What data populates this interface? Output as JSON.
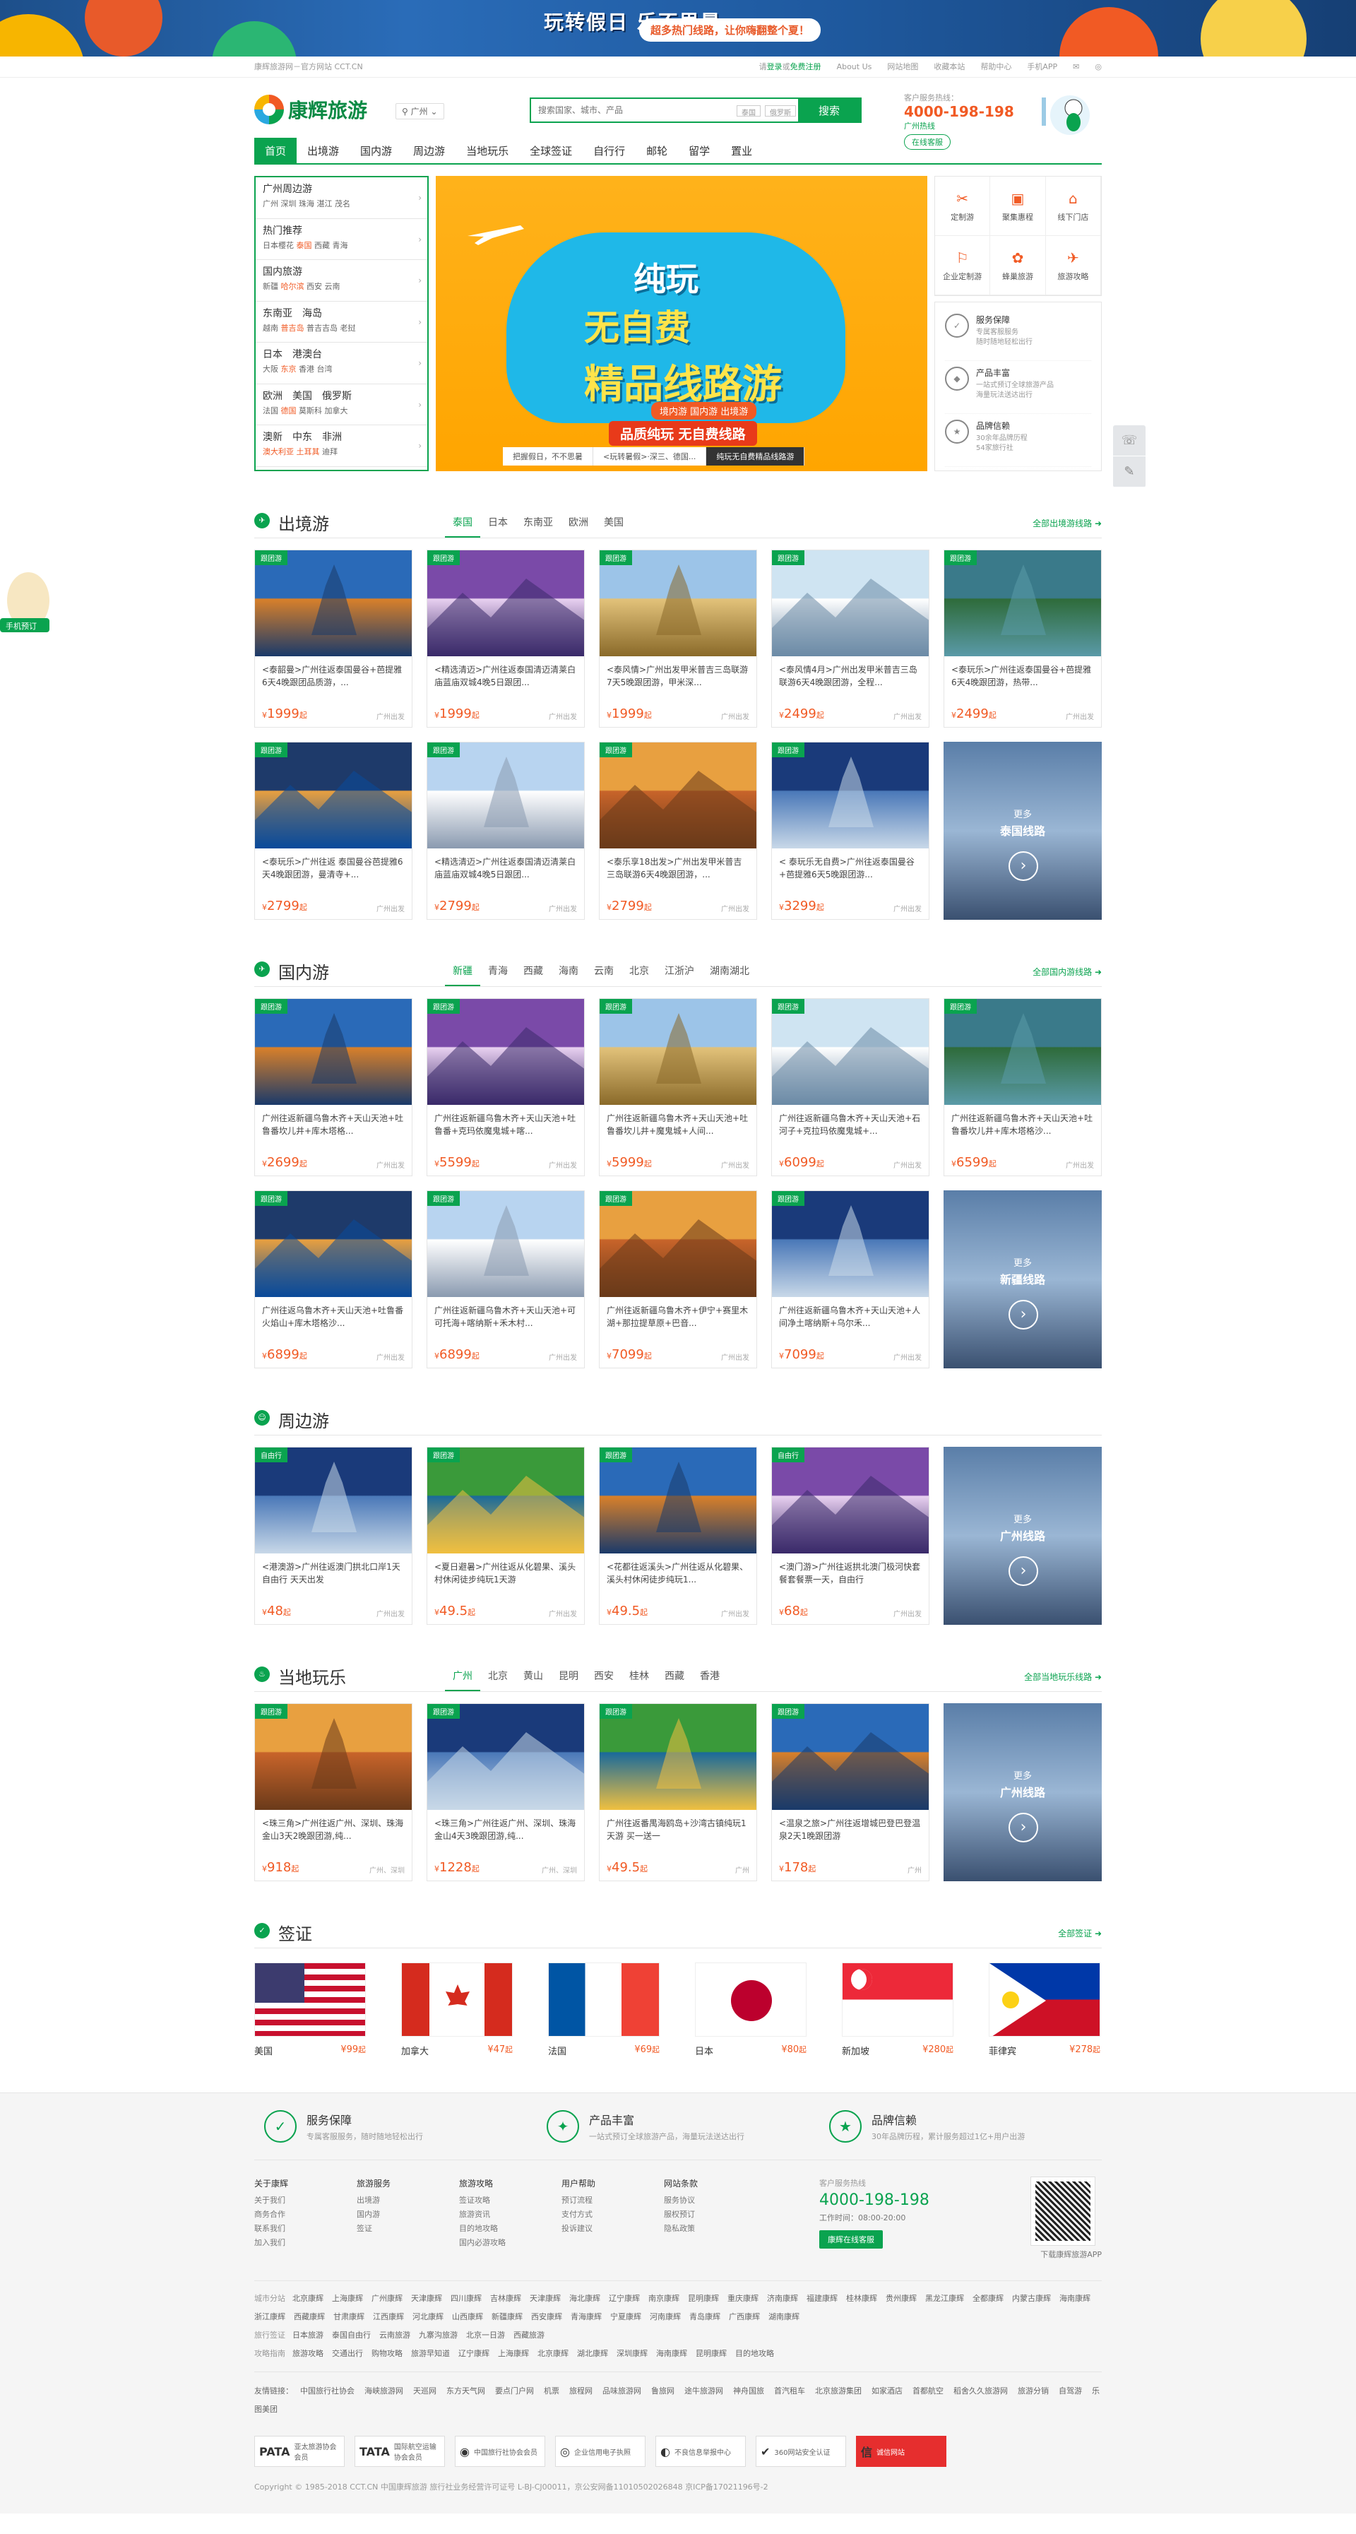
{
  "banner": {
    "slogan": "玩转假日 乐不思暑",
    "pill": "超多热门线路，让你嗨翻整个夏！"
  },
  "topbar": {
    "left": "康辉旅游网－官方网站 CCT.CN",
    "login_prefix": "请",
    "login": "登录",
    "or": "或",
    "register": "免费注册",
    "links": [
      "About Us",
      "网站地图",
      "收藏本站",
      "帮助中心",
      "手机APP"
    ]
  },
  "header": {
    "brand": "康辉旅游",
    "city": "广州",
    "search_placeholder": "搜索国家、城市、产品",
    "search_tags": [
      "泰国",
      "俄罗斯"
    ],
    "search_btn": "搜索",
    "hot_label": "客户服务热线：",
    "hot_number": "4000-198-198",
    "hot_sub": "广州热线",
    "hot_tag": "在线客服"
  },
  "nav": [
    "首页",
    "出境游",
    "国内游",
    "周边游",
    "当地玩乐",
    "全球签证",
    "自行行",
    "邮轮",
    "留学",
    "置业"
  ],
  "categories": [
    {
      "title": "广州周边游",
      "items": [
        "广州",
        "深圳",
        "珠海",
        "湛江",
        "茂名"
      ]
    },
    {
      "title": "热门推荐",
      "items": [
        "日本樱花",
        "泰国",
        "西藏",
        "青海"
      ]
    },
    {
      "title": "国内旅游",
      "items": [
        "新疆",
        "哈尔滨",
        "西安",
        "云南"
      ]
    },
    {
      "title": "东南亚　海岛",
      "items": [
        "越南",
        "普吉岛",
        "普吉吉岛",
        "老挝"
      ]
    },
    {
      "title": "日本　港澳台",
      "items": [
        "大阪",
        "东京",
        "香港",
        "台湾"
      ]
    },
    {
      "title": "欧洲　美国　俄罗斯",
      "items": [
        "法国",
        "德国",
        "莫斯科",
        "加拿大"
      ]
    },
    {
      "title": "澳新　中东　非洲",
      "items": [
        "澳大利亚",
        "土耳其",
        "迪拜"
      ]
    }
  ],
  "slide": {
    "t1": "纯玩",
    "t2": "无自费",
    "t3": "精品线路游",
    "t4": "境内游  国内游  出境游",
    "t5": "品质纯玩 无自费线路",
    "tabs": [
      "把握假日，不不思暑",
      "<玩转暑假>·深三、德国...",
      "纯玩无自费精品线路游"
    ]
  },
  "quick": [
    {
      "icon": "✂",
      "label": "定制游"
    },
    {
      "icon": "▣",
      "label": "聚集惠程"
    },
    {
      "icon": "⌂",
      "label": "线下门店"
    },
    {
      "icon": "⚐",
      "label": "企业定制游"
    },
    {
      "icon": "✿",
      "label": "蜂巢旅游"
    },
    {
      "icon": "✈",
      "label": "旅游攻略"
    }
  ],
  "trust": [
    {
      "title": "服务保障",
      "desc": "专属客服服务\n随时随地轻松出行"
    },
    {
      "title": "产品丰富",
      "desc": "一站式预订全球旅游产品\n海量玩法送达出行"
    },
    {
      "title": "品牌信赖",
      "desc": "30余年品牌历程\n54家旅行社"
    }
  ],
  "sections": {
    "outbound": {
      "title": "出境游",
      "tabs": [
        "泰国",
        "日本",
        "东南亚",
        "欧洲",
        "美国"
      ],
      "more": "全部出境游线路",
      "more_label": "更多",
      "more_title": "泰国线路",
      "cards": [
        {
          "badge": "跟团游",
          "title": "<泰韶曼>广州往返泰国曼谷+芭提雅6天4晚跟团品质游，...",
          "price": "1999",
          "from": "广州出发"
        },
        {
          "badge": "跟团游",
          "title": "<精选清迈>广州往返泰国清迈清莱白庙蓝庙双城4晚5日跟团...",
          "price": "1999",
          "from": "广州出发"
        },
        {
          "badge": "跟团游",
          "title": "<泰风情>广州出发甲米普吉三岛联游7天5晚跟团游，甲米深...",
          "price": "1999",
          "from": "广州出发"
        },
        {
          "badge": "跟团游",
          "title": "<泰风情4月>广州出发甲米普吉三岛联游6天4晚跟团游，全程...",
          "price": "2499",
          "from": "广州出发"
        },
        {
          "badge": "跟团游",
          "title": "<泰玩乐>广州往返泰国曼谷+芭提雅6天4晚跟团游，热带...",
          "price": "2499",
          "from": "广州出发"
        },
        {
          "badge": "跟团游",
          "title": "<泰玩乐>广州往返 泰国曼谷芭提雅6天4晚跟团游，曼清寺+...",
          "price": "2799",
          "from": "广州出发"
        },
        {
          "badge": "跟团游",
          "title": "<精选清迈>广州往返泰国清迈清莱白庙蓝庙双城4晚5日跟团...",
          "price": "2799",
          "from": "广州出发"
        },
        {
          "badge": "跟团游",
          "title": "<泰乐享18出发>广州出发甲米普吉三岛联游6天4晚跟团游，...",
          "price": "2799",
          "from": "广州出发"
        },
        {
          "badge": "跟团游",
          "title": "< 泰玩乐无自费>广州往返泰国曼谷+芭提雅6天5晚跟团游...",
          "price": "3299",
          "from": "广州出发"
        }
      ]
    },
    "domestic": {
      "title": "国内游",
      "tabs": [
        "新疆",
        "青海",
        "西藏",
        "海南",
        "云南",
        "北京",
        "江浙沪",
        "湖南湖北"
      ],
      "more": "全部国内游线路",
      "more_label": "更多",
      "more_title": "新疆线路",
      "cards": [
        {
          "badge": "跟团游",
          "title": "广州往返新疆乌鲁木齐+天山天池+吐鲁番坎儿井+库木塔格...",
          "price": "2699",
          "from": "广州出发"
        },
        {
          "badge": "跟团游",
          "title": "广州往返新疆乌鲁木齐+天山天池+吐鲁番+克玛依魔鬼城+喀...",
          "price": "5599",
          "from": "广州出发"
        },
        {
          "badge": "跟团游",
          "title": "广州往返新疆乌鲁木齐+天山天池+吐鲁番坎儿井+魔鬼城+人间...",
          "price": "5999",
          "from": "广州出发"
        },
        {
          "badge": "跟团游",
          "title": "广州往返新疆乌鲁木齐+天山天池+石河子+克拉玛依魔鬼城+...",
          "price": "6099",
          "from": "广州出发"
        },
        {
          "badge": "跟团游",
          "title": "广州往返新疆乌鲁木齐+天山天池+吐鲁番坎儿井+库木塔格沙...",
          "price": "6599",
          "from": "广州出发"
        },
        {
          "badge": "跟团游",
          "title": "广州往返乌鲁木齐+天山天池+吐鲁番火焰山+库木塔格沙...",
          "price": "6899",
          "from": "广州出发"
        },
        {
          "badge": "跟团游",
          "title": "广州往返新疆乌鲁木齐+天山天池+可可托海+喀纳斯+禾木村...",
          "price": "6899",
          "from": "广州出发"
        },
        {
          "badge": "跟团游",
          "title": "广州往返新疆乌鲁木齐+伊宁+赛里木湖+那拉提草原+巴音...",
          "price": "7099",
          "from": "广州出发"
        },
        {
          "badge": "跟团游",
          "title": "广州往返新疆乌鲁木齐+天山天池+人间净土喀纳斯+乌尔禾...",
          "price": "7099",
          "from": "广州出发"
        }
      ]
    },
    "nearby": {
      "title": "周边游",
      "more_label": "更多",
      "more_title": "广州线路",
      "cards": [
        {
          "badge": "自由行",
          "title": "<港澳游>广州往返澳门拱北口岸1天自由行 天天出发",
          "price": "48",
          "from": "广州出发"
        },
        {
          "badge": "跟团游",
          "title": "<夏日避暑>广州往返从化碧果、溪头村休闲徒步纯玩1天游",
          "price": "49.5",
          "from": "广州出发"
        },
        {
          "badge": "跟团游",
          "title": "<花都往返溪头>广州往返从化碧果、溪头村休闲徒步纯玩1...",
          "price": "49.5",
          "from": "广州出发"
        },
        {
          "badge": "自由行",
          "title": "<澳门游>广州往返拱北澳门极河快套餐套餐票一天，自由行",
          "price": "68",
          "from": "广州出发"
        }
      ]
    },
    "local": {
      "title": "当地玩乐",
      "tabs": [
        "广州",
        "北京",
        "黄山",
        "昆明",
        "西安",
        "桂林",
        "西藏",
        "香港"
      ],
      "more": "全部当地玩乐线路",
      "more_label": "更多",
      "more_title": "广州线路",
      "cards": [
        {
          "badge": "跟团游",
          "title": "<珠三角>广州往返广州、深圳、珠海金山3天2晚跟团游,纯...",
          "price": "918",
          "from": "广州、深圳"
        },
        {
          "badge": "跟团游",
          "title": "<珠三角>广州往返广州、深圳、珠海金山4天3晚跟团游,纯...",
          "price": "1228",
          "from": "广州、深圳"
        },
        {
          "badge": "跟团游",
          "title": "广州往返番禺海鸥岛+沙湾古镇纯玩1天游 买一送一",
          "price": "49.5",
          "from": "广州"
        },
        {
          "badge": "跟团游",
          "title": "<温泉之旅>广州往返增城巴登巴登温泉2天1晚跟团游",
          "price": "178",
          "from": "广州"
        }
      ]
    },
    "visa": {
      "title": "签证",
      "more": "全部签证",
      "items": [
        {
          "name": "美国",
          "price": "99"
        },
        {
          "name": "加拿大",
          "price": "47"
        },
        {
          "name": "法国",
          "price": "69"
        },
        {
          "name": "日本",
          "price": "80"
        },
        {
          "name": "新加坡",
          "price": "280"
        },
        {
          "name": "菲律宾",
          "price": "278"
        }
      ]
    }
  },
  "currency": "¥",
  "price_unit": "起",
  "float": {
    "left": "手机预订"
  },
  "footer": {
    "trust": [
      {
        "title": "服务保障",
        "desc": "专属客服服务，随时随地轻松出行"
      },
      {
        "title": "产品丰富",
        "desc": "一站式预订全球旅游产品，海量玩法送达出行"
      },
      {
        "title": "品牌信赖",
        "desc": "30年品牌历程，累计服务超过1亿+用户出游"
      }
    ],
    "cols": [
      {
        "h": "关于康辉",
        "items": [
          "关于我们",
          "商务合作",
          "联系我们",
          "加入我们"
        ]
      },
      {
        "h": "旅游服务",
        "items": [
          "出境游",
          "国内游",
          "签证"
        ]
      },
      {
        "h": "旅游攻略",
        "items": [
          "签证攻略",
          "旅游资讯",
          "目的地攻略",
          "国内必游攻略"
        ]
      },
      {
        "h": "用户帮助",
        "items": [
          "预订流程",
          "支付方式",
          "投诉建议"
        ]
      },
      {
        "h": "网站条款",
        "items": [
          "服务协议",
          "服权预订",
          "隐私政策"
        ]
      }
    ],
    "hot_label": "客户服务热线",
    "hot_number": "4000-198-198",
    "hot_time": "工作时间：08:00-20:00",
    "hot_btn": "康辉在线客服",
    "qr_label": "下载康辉旅游APP",
    "cities_label": "城市分站",
    "cities": [
      "北京康辉",
      "上海康辉",
      "广州康辉",
      "天津康辉",
      "四川康辉",
      "吉林康辉",
      "天津康辉",
      "海北康辉",
      "辽宁康辉",
      "南京康辉",
      "昆明康辉",
      "重庆康辉",
      "济南康辉",
      "福建康辉",
      "桂林康辉",
      "贵州康辉",
      "黑龙江康辉",
      "全都康辉",
      "内蒙古康辉",
      "海南康辉",
      "浙江康辉",
      "西藏康辉",
      "甘肃康辉",
      "江西康辉",
      "河北康辉",
      "山西康辉",
      "新疆康辉",
      "西安康辉",
      "青海康辉",
      "宁夏康辉",
      "河南康辉",
      "青岛康辉",
      "广西康辉",
      "湖南康辉"
    ],
    "dest_label": "旅行签证",
    "dest": [
      "日本旅游",
      "泰国自由行",
      "云南旅游",
      "九寨沟旅游",
      "北京一日游",
      "西藏旅游"
    ],
    "guide_label": "攻略指南",
    "guide": [
      "旅游攻略",
      "交通出行",
      "购物攻略",
      "旅游早知道",
      "辽宁康辉",
      "上海康辉",
      "北京康辉",
      "湖北康辉",
      "深圳康辉",
      "海南康辉",
      "昆明康辉",
      "目的地攻略"
    ],
    "friend_label": "友情链接：",
    "friends": [
      "中国旅行社协会",
      "海峡旅游网",
      "天巡网",
      "东方天气网",
      "要点门户网",
      "机票",
      "旅程网",
      "品味旅游网",
      "鲁旅网",
      "途牛旅游网",
      "神舟国旅",
      "首汽租车",
      "北京旅游集团",
      "如家酒店",
      "首都航空",
      "稻舍久久旅游网",
      "旅游分销",
      "自驾游",
      "乐图美团"
    ],
    "certs": [
      {
        "logo": "PATA",
        "text": "亚太旅游协会会员"
      },
      {
        "logo": "TATA",
        "text": "国际航空运输协会会员"
      },
      {
        "logo": "◉",
        "text": "中国旅行社协会会员"
      },
      {
        "logo": "◎",
        "text": "企业信用电子执照"
      },
      {
        "logo": "◐",
        "text": "不良信息举报中心"
      },
      {
        "logo": "✔",
        "text": "360网站安全认证"
      },
      {
        "logo": "信",
        "text": "诚信网站"
      }
    ],
    "copyright": "Copyright © 1985-2018 CCT.CN 中国康辉旅游 旅行社业务经营许可证号 L-BJ-CJ00011，京公安网备11010502026848 京ICP备17021196号-2"
  }
}
